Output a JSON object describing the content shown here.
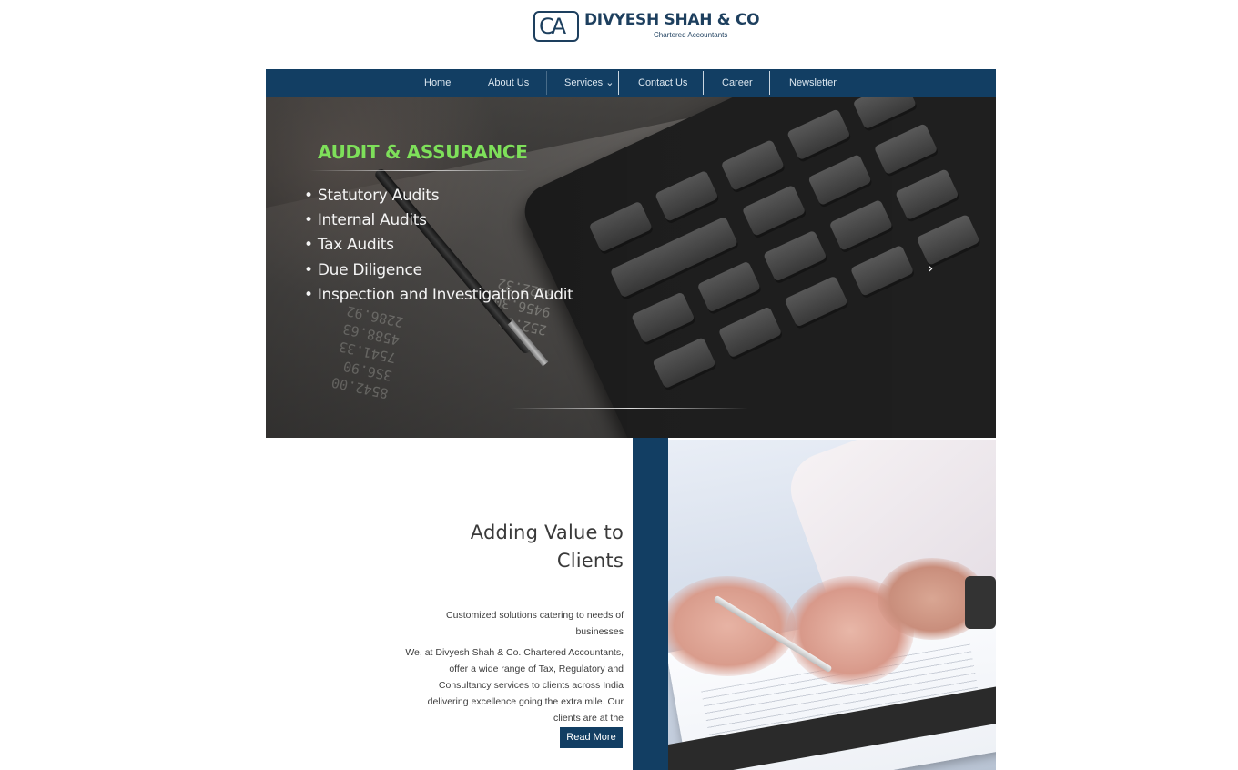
{
  "brand": {
    "mark": "CA",
    "name": "DIVYESH SHAH & CO",
    "subtitle": "Chartered Accountants"
  },
  "nav": {
    "items": [
      "Home",
      "About Us",
      "Services ⌄",
      "Contact Us",
      "Career",
      "Newsletter"
    ]
  },
  "hero": {
    "title": "AUDIT & ASSURANCE",
    "items": [
      "• Statutory Audits",
      "• Internal Audits",
      "• Tax Audits",
      "• Due Diligence",
      "• Inspection and Investigation Audit"
    ],
    "next_arrow": "›"
  },
  "about": {
    "title": "Adding Value to Clients",
    "tagline": "Customized solutions catering to needs of businesses",
    "body": "We, at Divyesh Shah & Co. Chartered Accountants, offer a wide range of Tax, Regulatory and Consultancy services to clients across India delivering excellence going the extra mile. Our clients are at the",
    "button": "Read More"
  },
  "colors": {
    "navy": "#123e63",
    "hero_title": "#7ee05a"
  }
}
